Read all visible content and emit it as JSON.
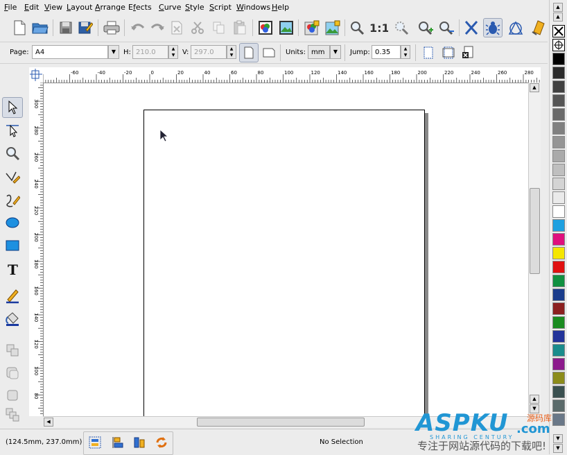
{
  "menubar": {
    "items": [
      {
        "label": "File",
        "ul": "F",
        "rest": "ile"
      },
      {
        "label": "Edit",
        "ul": "E",
        "rest": "dit"
      },
      {
        "label": "View",
        "ul": "V",
        "rest": "iew"
      },
      {
        "label": "Layout",
        "ul": "L",
        "rest": "ayout"
      },
      {
        "label": "Arrange",
        "ul": "A",
        "rest": "rrange"
      },
      {
        "label": "Effects",
        "ul": "f",
        "pre": "E",
        "rest": "ects"
      },
      {
        "label": "Curve",
        "ul": "C",
        "rest": "urve"
      },
      {
        "label": "Style",
        "ul": "S",
        "rest": "tyle"
      },
      {
        "label": "Script",
        "ul": "S",
        "rest": "cript"
      },
      {
        "label": "Windows",
        "ul": "W",
        "rest": "indows"
      },
      {
        "label": "Help",
        "ul": "H",
        "rest": "elp"
      }
    ]
  },
  "pagebar": {
    "page_label": "Page:",
    "page_value": "A4",
    "h_label": "H:",
    "h_value": "210.0",
    "v_label": "V:",
    "v_value": "297.0",
    "units_label": "Units:",
    "units_value": "mm",
    "jump_label": "Jump:",
    "jump_value": "0.35"
  },
  "rulers": {
    "h_ticks": [
      "-60",
      "-40",
      "-20",
      "0",
      "20",
      "40",
      "60",
      "80",
      "100",
      "120",
      "140",
      "160",
      "180",
      "200",
      "220",
      "240",
      "260",
      "280"
    ],
    "v_ticks": [
      "300",
      "280",
      "260",
      "240",
      "220",
      "200",
      "180",
      "160",
      "140",
      "120",
      "100",
      "80",
      "60"
    ]
  },
  "statusbar": {
    "coords": "(124.5mm, 237.0mm)",
    "selection": "No Selection"
  },
  "palette": {
    "colors": [
      "#000000",
      "#2b2b2b",
      "#404040",
      "#555555",
      "#6a6a6a",
      "#808080",
      "#959595",
      "#aaaaaa",
      "#bfbfbf",
      "#d4d4d4",
      "#eaeaea",
      "#ffffff",
      "#1ea0e0",
      "#e0107e",
      "#f5e600",
      "#e01010",
      "#109040",
      "#1a3c8c",
      "#8c2020",
      "#1a8c20",
      "#22339a",
      "#1a8c8c",
      "#8c1a8c",
      "#8c8c1a",
      "#3a5050",
      "#5a6a6a",
      "#6a7888"
    ]
  },
  "watermark": {
    "brand": "ASPKU",
    "tld": ".com",
    "cn_top": "源码库",
    "cn_bottom": "专注于网站源代码的下载吧!",
    "subtitle": "SHARING CENTURY"
  }
}
